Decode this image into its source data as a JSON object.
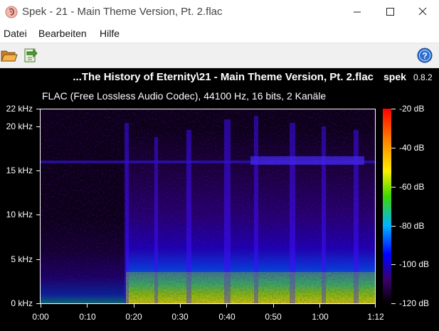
{
  "window": {
    "title": "Spek - 21 - Main Theme Version, Pt. 2.flac",
    "app_icon": "spek-ear-icon",
    "controls": [
      "minimize-icon",
      "maximize-icon",
      "close-icon"
    ]
  },
  "menu": {
    "items": [
      "Datei",
      "Bearbeiten",
      "Hilfe"
    ]
  },
  "toolbar": {
    "buttons": [
      "open-folder-icon",
      "save-icon"
    ],
    "help_icon": "help-icon"
  },
  "spectrogram": {
    "file_title": "...The History of Eternity\\21 - Main Theme Version, Pt. 2.flac",
    "brand": "spek",
    "version": "0.8.2",
    "subtitle": "FLAC (Free Lossless Audio Codec), 44100 Hz, 16 bits, 2 Kanäle",
    "freq_labels": [
      "22 kHz",
      "20 kHz",
      "15 kHz",
      "10 kHz",
      "5 kHz",
      "0 kHz"
    ],
    "time_labels": [
      "0:00",
      "0:10",
      "0:20",
      "0:30",
      "0:40",
      "0:50",
      "1:00",
      "1:12"
    ],
    "db_labels": [
      "-20 dB",
      "-40 dB",
      "-60 dB",
      "-80 dB",
      "-100 dB",
      "-120 dB"
    ],
    "colors": {
      "background": "#000000",
      "low": "#1a0060",
      "mid": "#00b4ff",
      "high": "#ffee00",
      "peak": "#ff0000"
    }
  }
}
